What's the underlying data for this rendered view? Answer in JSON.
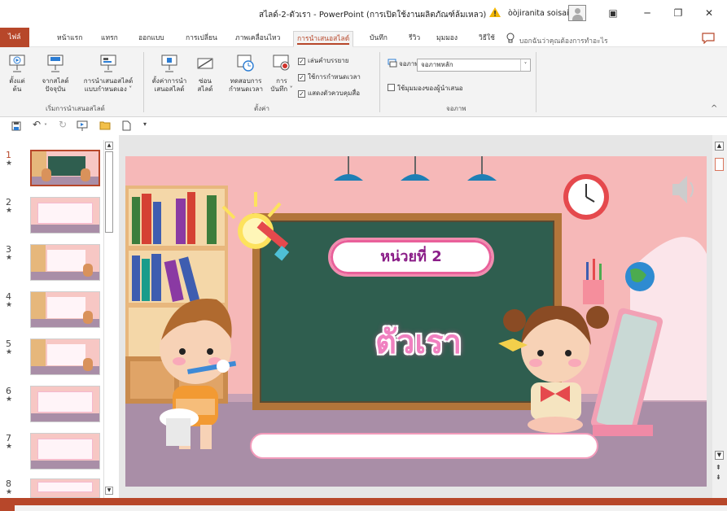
{
  "window": {
    "title": "สไลด์-2-ตัวเรา  -  PowerPoint (การเปิดใช้งานผลิตภัณฑ์ล้มเหลว)",
    "user": "òòjiranita soisai",
    "minimize": "─",
    "restore": "❐",
    "close": "✕",
    "ribbon_display": "▣"
  },
  "tabs": [
    {
      "label": "ไฟล์",
      "active": false
    },
    {
      "label": "หน้าแรก",
      "active": false
    },
    {
      "label": "แทรก",
      "active": false
    },
    {
      "label": "ออกแบบ",
      "active": false
    },
    {
      "label": "การเปลี่ยน",
      "active": false
    },
    {
      "label": "ภาพเคลื่อนไหว",
      "active": false
    },
    {
      "label": "การนำเสนอสไลด์",
      "active": true
    },
    {
      "label": "บันทึก",
      "active": false
    },
    {
      "label": "รีวิว",
      "active": false
    },
    {
      "label": "มุมมอง",
      "active": false
    },
    {
      "label": "วิธีใช้",
      "active": false
    }
  ],
  "tell_me": "บอกฉันว่าคุณต้องการทำอะไร",
  "ribbon": {
    "start_group": {
      "label": "เริ่มการนำเสนอสไลด์",
      "from_beginning": [
        "ตั้งแต่",
        "ต้น"
      ],
      "from_current": [
        "จากสไลด์",
        "ปัจจุบัน"
      ],
      "custom": [
        "การนำเสนอสไลด์",
        "แบบกำหนดเอง ˅"
      ]
    },
    "setup_group": {
      "label": "ตั้งค่า",
      "setup": [
        "ตั้งค่าการนำ",
        "เสนอสไลด์"
      ],
      "hide": [
        "ซ่อน",
        "สไลด์"
      ],
      "rehearse": [
        "ทดสอบการ",
        "กำหนดเวลา"
      ],
      "record": [
        "การ",
        "บันทึก ˅"
      ],
      "play_narrations": "เล่นคำบรรยาย",
      "use_timings": "ใช้การกำหนดเวลา",
      "show_controls": "แสดงตัวควบคุมสื่อ"
    },
    "monitors_group": {
      "label": "จอภาพ",
      "monitor_label": "จอภาพ:",
      "monitor_value": "จอภาพหลัก",
      "presenter_view": "ใช้มุมมองของผู้นำเสนอ"
    }
  },
  "thumbnails": [
    {
      "num": "1",
      "selected": true,
      "style": "board"
    },
    {
      "num": "2",
      "selected": false,
      "style": "light"
    },
    {
      "num": "3",
      "selected": false,
      "style": "board"
    },
    {
      "num": "4",
      "selected": false,
      "style": "board"
    },
    {
      "num": "5",
      "selected": false,
      "style": "board"
    },
    {
      "num": "6",
      "selected": false,
      "style": "light"
    },
    {
      "num": "7",
      "selected": false,
      "style": "light"
    },
    {
      "num": "8",
      "selected": false,
      "style": "light"
    }
  ],
  "thumb_star": "★",
  "slide": {
    "unit_label": "หน่วยที่ 2",
    "main_title": "ตัวเรา"
  },
  "colors": {
    "accent": "#b7472a",
    "board": "#2f5e4f",
    "wall": "#f6b8b8",
    "title_pink": "#f080c0"
  }
}
